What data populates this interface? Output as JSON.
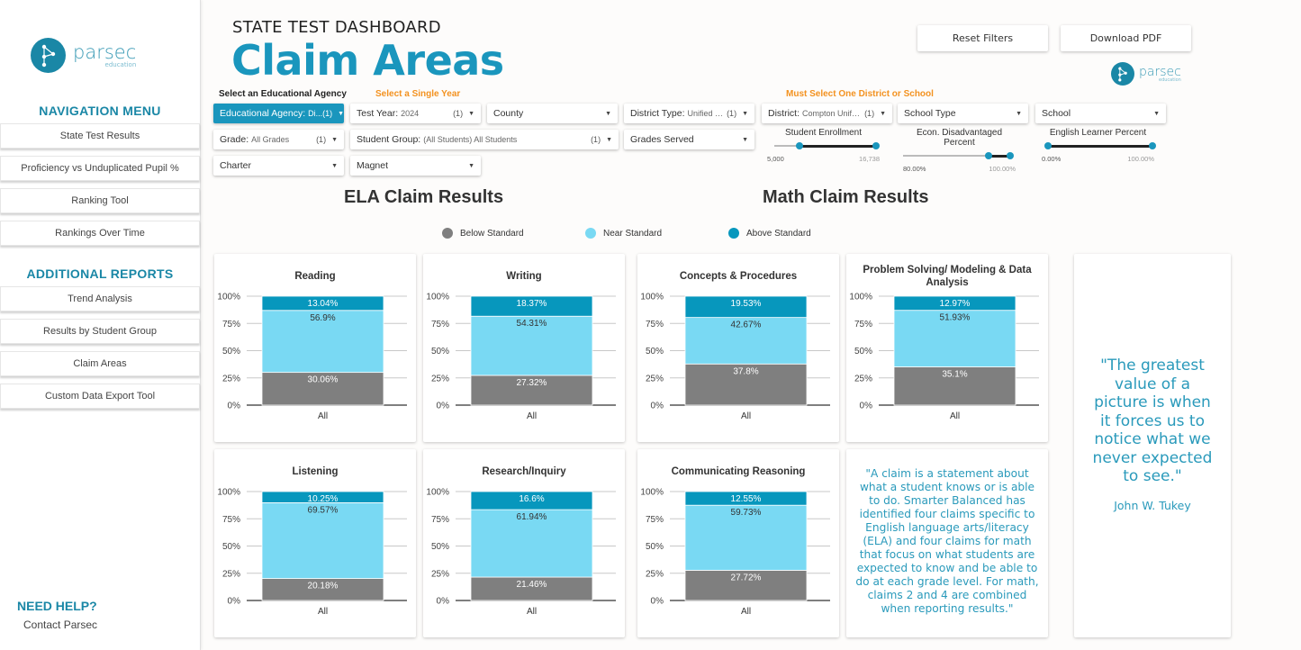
{
  "sidebar": {
    "logo": {
      "word": "parsec",
      "sub": "education"
    },
    "nav_heading": "NAVIGATION MENU",
    "nav_items": [
      {
        "label": "State Test Results"
      },
      {
        "label": "Proficiency vs Unduplicated Pupil %"
      },
      {
        "label": "Ranking Tool"
      },
      {
        "label": "Rankings Over Time"
      }
    ],
    "reports_heading": "ADDITIONAL REPORTS",
    "report_items": [
      {
        "label": "Trend Analysis"
      },
      {
        "label": "Results by Student Group"
      },
      {
        "label": "Claim Areas"
      },
      {
        "label": "Custom Data Export Tool"
      }
    ],
    "help_heading": "NEED HELP?",
    "help_link": "Contact Parsec"
  },
  "header": {
    "supertitle": "STATE TEST DASHBOARD",
    "title": "Claim Areas",
    "reset_label": "Reset Filters",
    "download_label": "Download PDF",
    "logo": {
      "word": "parsec",
      "sub": "education"
    }
  },
  "filters": {
    "label_agency": "Select an Educational Agency",
    "label_year": "Select a Single Year",
    "label_district": "Must Select One District or School",
    "colors": {
      "label_dark": "#222222",
      "label_orange": "#f39220",
      "accent": "#1a96bd"
    },
    "educational_agency": {
      "name": "Educational Agency",
      "value": "Di...",
      "count": "(1)"
    },
    "test_year": {
      "name": "Test Year",
      "value": "2024",
      "count": "(1)"
    },
    "county": {
      "name": "County"
    },
    "district_type": {
      "name": "District Type",
      "value": "Unified Sc...",
      "count": "(1)"
    },
    "district": {
      "name": "District",
      "value": "Compton Unified",
      "count": "(1)"
    },
    "school_type": {
      "name": "School Type"
    },
    "school": {
      "name": "School"
    },
    "grade": {
      "name": "Grade",
      "value": "All Grades",
      "count": "(1)"
    },
    "student_group": {
      "name": "Student Group",
      "value": "(All Students) All Students",
      "count": "(1)"
    },
    "grades_served": {
      "name": "Grades Served"
    },
    "charter": {
      "name": "Charter"
    },
    "magnet": {
      "name": "Magnet"
    },
    "sliders": [
      {
        "label": "Student Enrollment",
        "min_label": "5,000",
        "max_label": "16,738",
        "low_frac": 0.25,
        "high_frac": 1.0
      },
      {
        "label": "Econ. Disadvantaged Percent",
        "min_label": "80.00%",
        "max_label": "100.00%",
        "low_frac": 0.8,
        "high_frac": 1.0
      },
      {
        "label": "English Learner Percent",
        "min_label": "0.00%",
        "max_label": "100.00%",
        "low_frac": 0.0,
        "high_frac": 1.0
      }
    ]
  },
  "sections": {
    "ela_title": "ELA Claim Results",
    "math_title": "Math Claim Results"
  },
  "legend": [
    {
      "label": "Below Standard",
      "color": "#7f7f7f"
    },
    {
      "label": "Near Standard",
      "color": "#79d9f3"
    },
    {
      "label": "Above Standard",
      "color": "#0797bd"
    }
  ],
  "chart_data": [
    {
      "type": "bar",
      "stacked": true,
      "title": "Reading",
      "categories": [
        "All"
      ],
      "ylim": [
        0,
        100
      ],
      "yticks": [
        "0%",
        "25%",
        "50%",
        "75%",
        "100%"
      ],
      "series": [
        {
          "name": "Below Standard",
          "values": [
            30.06
          ]
        },
        {
          "name": "Near Standard",
          "values": [
            56.9
          ]
        },
        {
          "name": "Above Standard",
          "values": [
            13.04
          ]
        }
      ]
    },
    {
      "type": "bar",
      "stacked": true,
      "title": "Writing",
      "categories": [
        "All"
      ],
      "ylim": [
        0,
        100
      ],
      "yticks": [
        "0%",
        "25%",
        "50%",
        "75%",
        "100%"
      ],
      "series": [
        {
          "name": "Below Standard",
          "values": [
            27.32
          ]
        },
        {
          "name": "Near Standard",
          "values": [
            54.31
          ]
        },
        {
          "name": "Above Standard",
          "values": [
            18.37
          ]
        }
      ]
    },
    {
      "type": "bar",
      "stacked": true,
      "title": "Concepts & Procedures",
      "categories": [
        "All"
      ],
      "ylim": [
        0,
        100
      ],
      "yticks": [
        "0%",
        "25%",
        "50%",
        "75%",
        "100%"
      ],
      "series": [
        {
          "name": "Below Standard",
          "values": [
            37.8
          ]
        },
        {
          "name": "Near Standard",
          "values": [
            42.67
          ]
        },
        {
          "name": "Above Standard",
          "values": [
            19.53
          ]
        }
      ]
    },
    {
      "type": "bar",
      "stacked": true,
      "title": "Problem Solving/ Modeling & Data Analysis",
      "categories": [
        "All"
      ],
      "ylim": [
        0,
        100
      ],
      "yticks": [
        "0%",
        "25%",
        "50%",
        "75%",
        "100%"
      ],
      "series": [
        {
          "name": "Below Standard",
          "values": [
            35.1
          ]
        },
        {
          "name": "Near Standard",
          "values": [
            51.93
          ]
        },
        {
          "name": "Above Standard",
          "values": [
            12.97
          ]
        }
      ]
    },
    {
      "type": "bar",
      "stacked": true,
      "title": "Listening",
      "categories": [
        "All"
      ],
      "ylim": [
        0,
        100
      ],
      "yticks": [
        "0%",
        "25%",
        "50%",
        "75%",
        "100%"
      ],
      "series": [
        {
          "name": "Below Standard",
          "values": [
            20.18
          ]
        },
        {
          "name": "Near Standard",
          "values": [
            69.57
          ]
        },
        {
          "name": "Above Standard",
          "values": [
            10.25
          ]
        }
      ]
    },
    {
      "type": "bar",
      "stacked": true,
      "title": "Research/Inquiry",
      "categories": [
        "All"
      ],
      "ylim": [
        0,
        100
      ],
      "yticks": [
        "0%",
        "25%",
        "50%",
        "75%",
        "100%"
      ],
      "series": [
        {
          "name": "Below Standard",
          "values": [
            21.46
          ]
        },
        {
          "name": "Near Standard",
          "values": [
            61.94
          ]
        },
        {
          "name": "Above Standard",
          "values": [
            16.6
          ]
        }
      ]
    },
    {
      "type": "bar",
      "stacked": true,
      "title": "Communicating Reasoning",
      "categories": [
        "All"
      ],
      "ylim": [
        0,
        100
      ],
      "yticks": [
        "0%",
        "25%",
        "50%",
        "75%",
        "100%"
      ],
      "series": [
        {
          "name": "Below Standard",
          "values": [
            27.72
          ]
        },
        {
          "name": "Near Standard",
          "values": [
            59.73
          ]
        },
        {
          "name": "Above Standard",
          "values": [
            12.55
          ]
        }
      ]
    }
  ],
  "claim_note": "\"A claim is a statement about what a student knows or is able to do. Smarter Balanced has identified four claims specific to English language arts/literacy (ELA) and four claims for math that focus on what students are expected to know and be able to do at each grade level. For math, claims 2 and 4 are combined when reporting results.\"",
  "quote": {
    "text": "\"The greatest value of a picture is when it forces us to notice what we never expected to see.\"",
    "author": "John W. Tukey"
  }
}
